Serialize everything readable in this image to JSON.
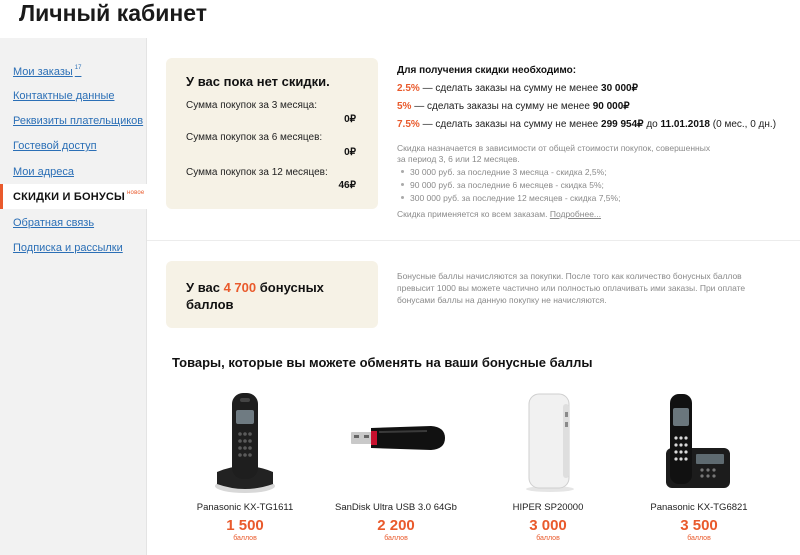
{
  "header": {
    "title": "Личный кабинет"
  },
  "sidebar": {
    "items": [
      {
        "label": "Мои заказы",
        "badge": "17"
      },
      {
        "label": "Контактные данные"
      },
      {
        "label": "Реквизиты плательщиков"
      },
      {
        "label": "Гостевой доступ"
      },
      {
        "label": "Мои адреса"
      },
      {
        "label": "СКИДКИ И БОНУСЫ",
        "badge": "новое",
        "active": true
      },
      {
        "label": "Обратная связь"
      },
      {
        "label": "Подписка и рассылки"
      }
    ]
  },
  "discount": {
    "title": "У вас пока нет скидки.",
    "rows": [
      {
        "label": "Сумма покупок за 3 месяца:",
        "value": "0₽"
      },
      {
        "label": "Сумма покупок за 6 месяцев:",
        "value": "0₽"
      },
      {
        "label": "Сумма покупок за 12 месяцев:",
        "value": "46₽"
      }
    ]
  },
  "requirements": {
    "title": "Для получения скидки необходимо:",
    "rows": [
      {
        "pct": "2.5%",
        "text": " — сделать заказы на сумму не менее ",
        "amount": "30 000₽",
        "suffix": ""
      },
      {
        "pct": "5%",
        "text": " — сделать заказы на сумму не менее ",
        "amount": "90 000₽",
        "suffix": ""
      },
      {
        "pct": "7.5%",
        "text": " — сделать заказы на сумму не менее ",
        "amount": "299 954₽",
        "mid": " до ",
        "date": "11.01.2018",
        "suffix": " (0 мес., 0 дн.)"
      }
    ],
    "note": "Скидка назначается в зависимости от общей стоимости покупок, совершенных за период 3, 6 или 12 месяцев.",
    "list": [
      "30 000 руб. за последние 3 месяца - скидка 2,5%;",
      "90 000 руб. за последние 6 месяцев - скидка 5%;",
      "300 000 руб. за последние 12 месяцев - скидка 7,5%;"
    ],
    "foot": "Скидка применяется ко всем заказам.",
    "foot_link": "Подробнее..."
  },
  "bonus": {
    "prefix": "У вас ",
    "amount": "4 700",
    "suffix": " бонусных баллов",
    "note": "Бонусные баллы начисляются за покупки. После того как количество бонусных баллов превысит 1000 вы можете частично или полностью оплачивать ими заказы. При оплате бонусами баллы на данную покупку не начисляются."
  },
  "goods": {
    "title": "Товары, которые вы можете обменять на ваши бонусные баллы",
    "items": [
      {
        "name": "Panasonic KX-TG1611",
        "price": "1 500",
        "unit": "баллов",
        "icon": "cordless-phone"
      },
      {
        "name": "SanDisk Ultra USB 3.0 64Gb",
        "price": "2 200",
        "unit": "баллов",
        "icon": "usb-flash-drive"
      },
      {
        "name": "HIPER SP20000",
        "price": "3 000",
        "unit": "баллов",
        "icon": "power-bank"
      },
      {
        "name": "Panasonic KX-TG6821",
        "price": "3 500",
        "unit": "баллов",
        "icon": "cordless-phone-base"
      }
    ]
  },
  "colors": {
    "accent": "#e95a2c",
    "link": "#2b6fb6",
    "box": "#f6f2e6",
    "sidebar": "#f2f2f2"
  }
}
